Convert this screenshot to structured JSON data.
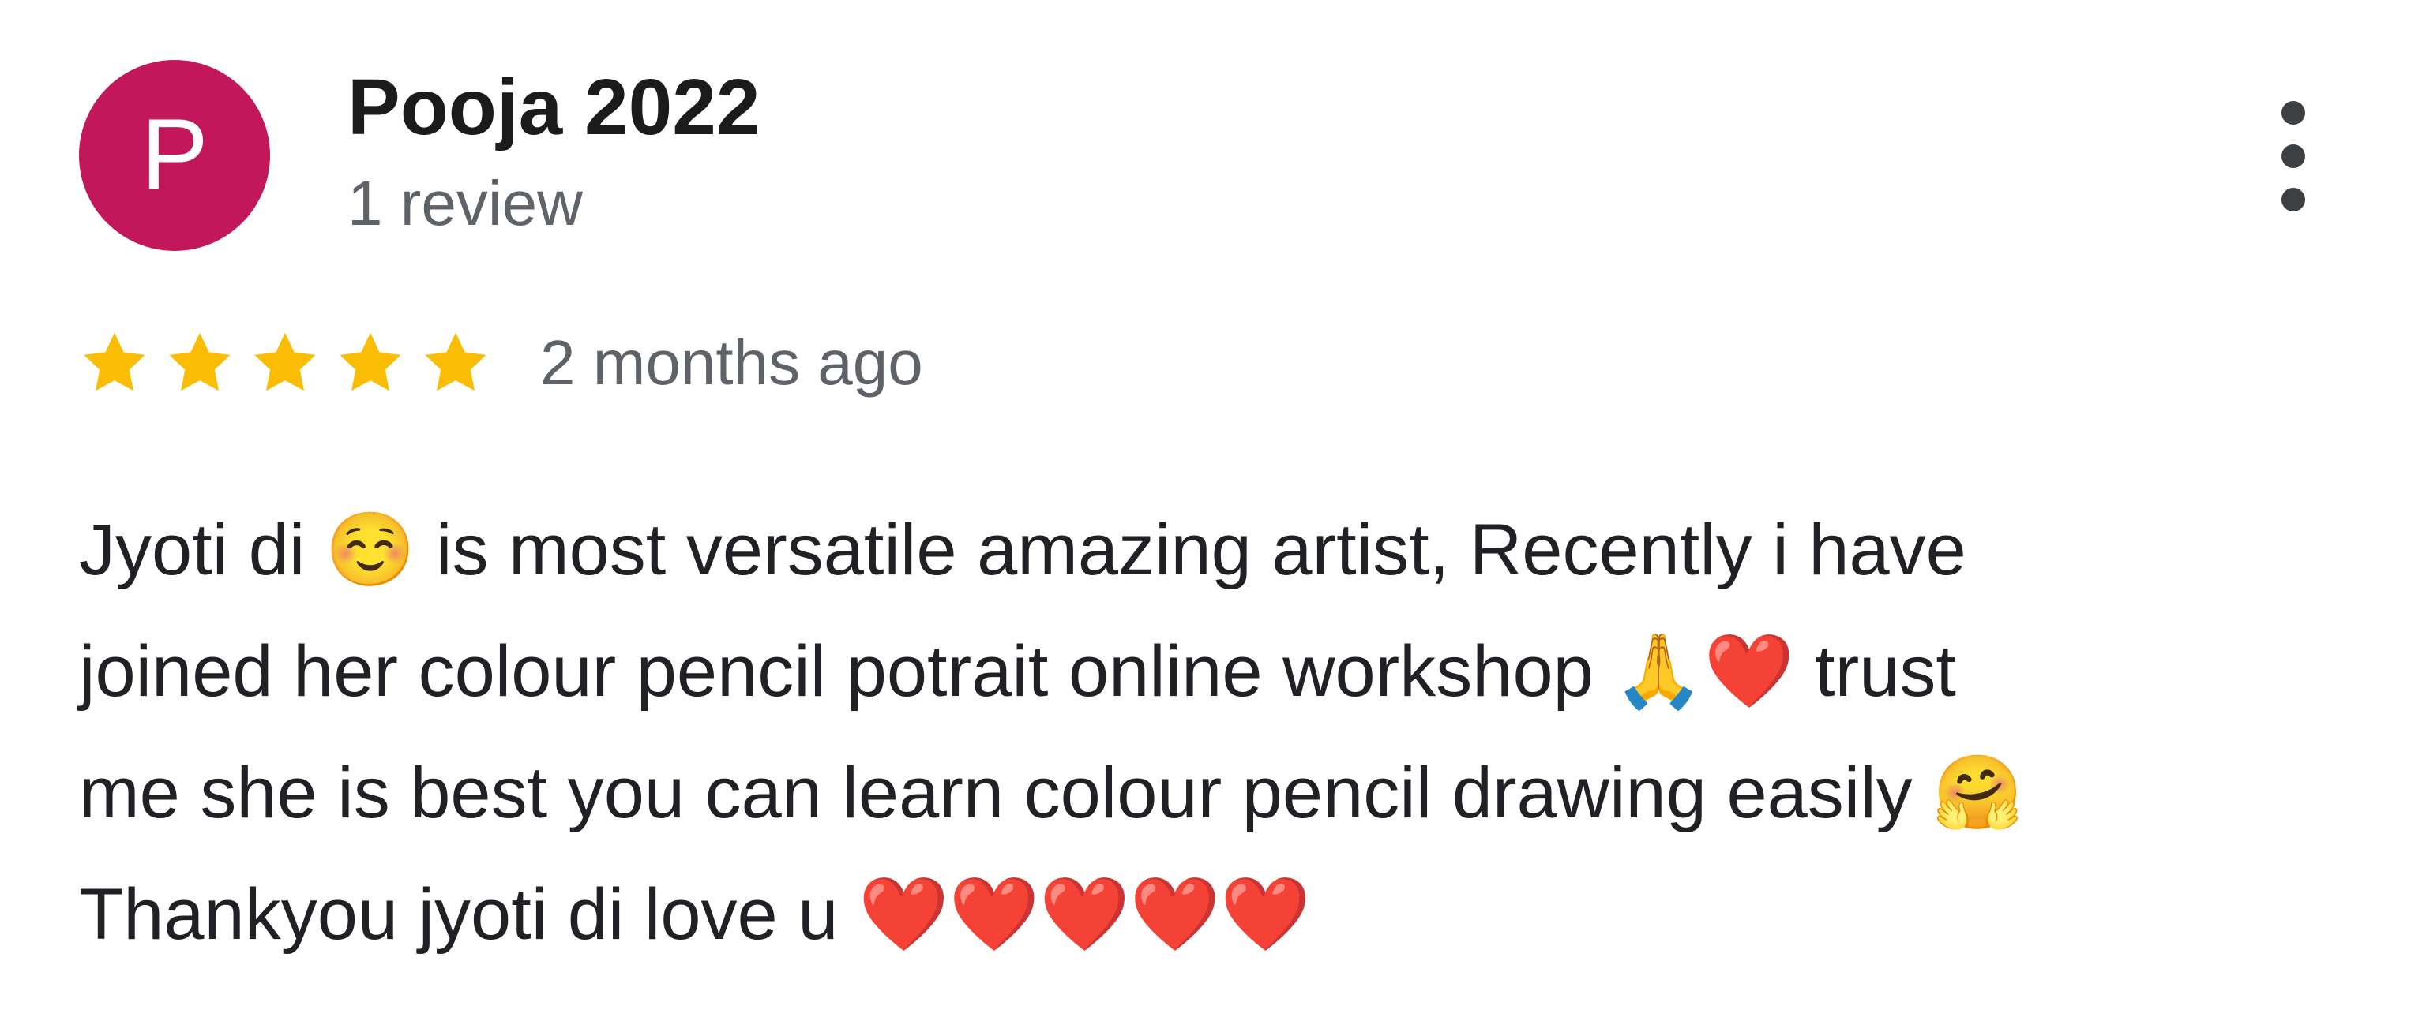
{
  "review": {
    "author": {
      "initial": "P",
      "name": "Pooja 2022",
      "meta": "1 review",
      "avatar_color": "#c2185b"
    },
    "menu_icon": "more-vert-icon",
    "rating": {
      "stars": 5,
      "max": 5,
      "star_color": "#fbbc04"
    },
    "date": "2 months ago",
    "text_lines": [
      "Jyoti di ☺️ is most versatile amazing artist, Recently i have",
      "joined her colour pencil potrait online workshop 🙏❤️ trust",
      "me she is best you can learn colour pencil drawing easily 🤗",
      "Thankyou jyoti di love u ❤️❤️❤️❤️❤️"
    ]
  }
}
